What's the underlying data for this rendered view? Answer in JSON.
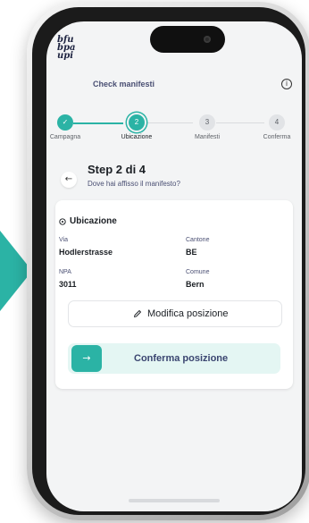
{
  "app": {
    "logo_lines": [
      "bfu",
      "bpa",
      "upi"
    ],
    "title": "Check manifesti",
    "info_icon": "info-icon"
  },
  "stepper": {
    "steps": [
      {
        "number": "✓",
        "label": "Campagna",
        "state": "done"
      },
      {
        "number": "2",
        "label": "Ubicazione",
        "state": "current"
      },
      {
        "number": "3",
        "label": "Manifesti",
        "state": "pending"
      },
      {
        "number": "4",
        "label": "Conferma",
        "state": "pending"
      }
    ]
  },
  "header": {
    "back_icon": "arrow-left-icon",
    "title": "Step 2 di 4",
    "subtitle": "Dove hai affisso il manifesto?"
  },
  "location": {
    "title": "Ubicazione",
    "fields": {
      "via_label": "Via",
      "via_value": "Hodlerstrasse",
      "cantone_label": "Cantone",
      "cantone_value": "BE",
      "npa_label": "NPA",
      "npa_value": "3011",
      "comune_label": "Comune",
      "comune_value": "Bern"
    },
    "modify_label": "Modifica posizione",
    "confirm_label": "Conferma posizione"
  },
  "colors": {
    "accent": "#2bb3a5",
    "accent_light": "#e4f6f3",
    "text_primary": "#1b1f24",
    "text_secondary": "#4a4f73"
  }
}
